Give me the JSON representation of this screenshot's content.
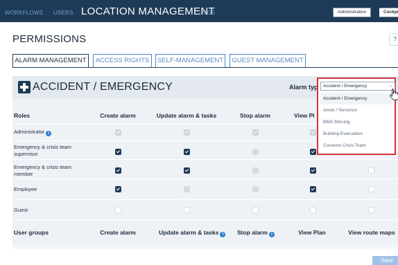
{
  "topbar": {
    "nav": [
      {
        "label": "WORKFLOWS"
      },
      {
        "label": "USERS"
      },
      {
        "label": "LOCATION MANAGEMENT"
      },
      {
        "label": "LOGS"
      }
    ],
    "switch_admin": "Administration",
    "switch_cockpit": "Cockpit"
  },
  "page": {
    "title": "PERMISSIONS",
    "help": "?"
  },
  "tabs": [
    {
      "label": "ALARM MANAGEMENT",
      "active": true
    },
    {
      "label": "ACCESS RIGHTS"
    },
    {
      "label": "SELF-MANAGEMENT"
    },
    {
      "label": "GUEST MANAGEMENT"
    }
  ],
  "panel": {
    "title": "ACCIDENT / EMERGENCY",
    "alarm_type_label": "Alarm type"
  },
  "dropdown": {
    "selected": "Accident / Emergency",
    "options": [
      "Accident / Emergency",
      "Amok / Terrorism",
      "BMA Störung",
      "Building Evacuation",
      "Convene Crisis Team"
    ]
  },
  "roles_table": {
    "header": "Roles",
    "columns": [
      "Create alarm",
      "Update alarm & tasks",
      "Stop alarm",
      "View Pl"
    ],
    "rows": [
      {
        "label": "Administrator",
        "info": "i",
        "states": [
          "dis",
          "dis",
          "dis",
          "dis",
          "none"
        ]
      },
      {
        "label": "Emergency & crisis team supervisor",
        "states": [
          "on",
          "on",
          "grey",
          "on",
          "none"
        ]
      },
      {
        "label": "Emergency & crisis team member",
        "states": [
          "on",
          "on",
          "grey",
          "on",
          "empty"
        ]
      },
      {
        "label": "Employee",
        "states": [
          "on",
          "grey",
          "grey",
          "on",
          "empty"
        ]
      },
      {
        "label": "Guest",
        "states": [
          "empty",
          "empty",
          "empty",
          "empty",
          "empty"
        ]
      }
    ]
  },
  "groups_table": {
    "header": "User groups",
    "columns": [
      "Create alarm",
      "Update alarm & tasks",
      "Stop alarm",
      "View Plan",
      "View route maps"
    ],
    "info": "i"
  },
  "footer": {
    "save": "Save"
  }
}
